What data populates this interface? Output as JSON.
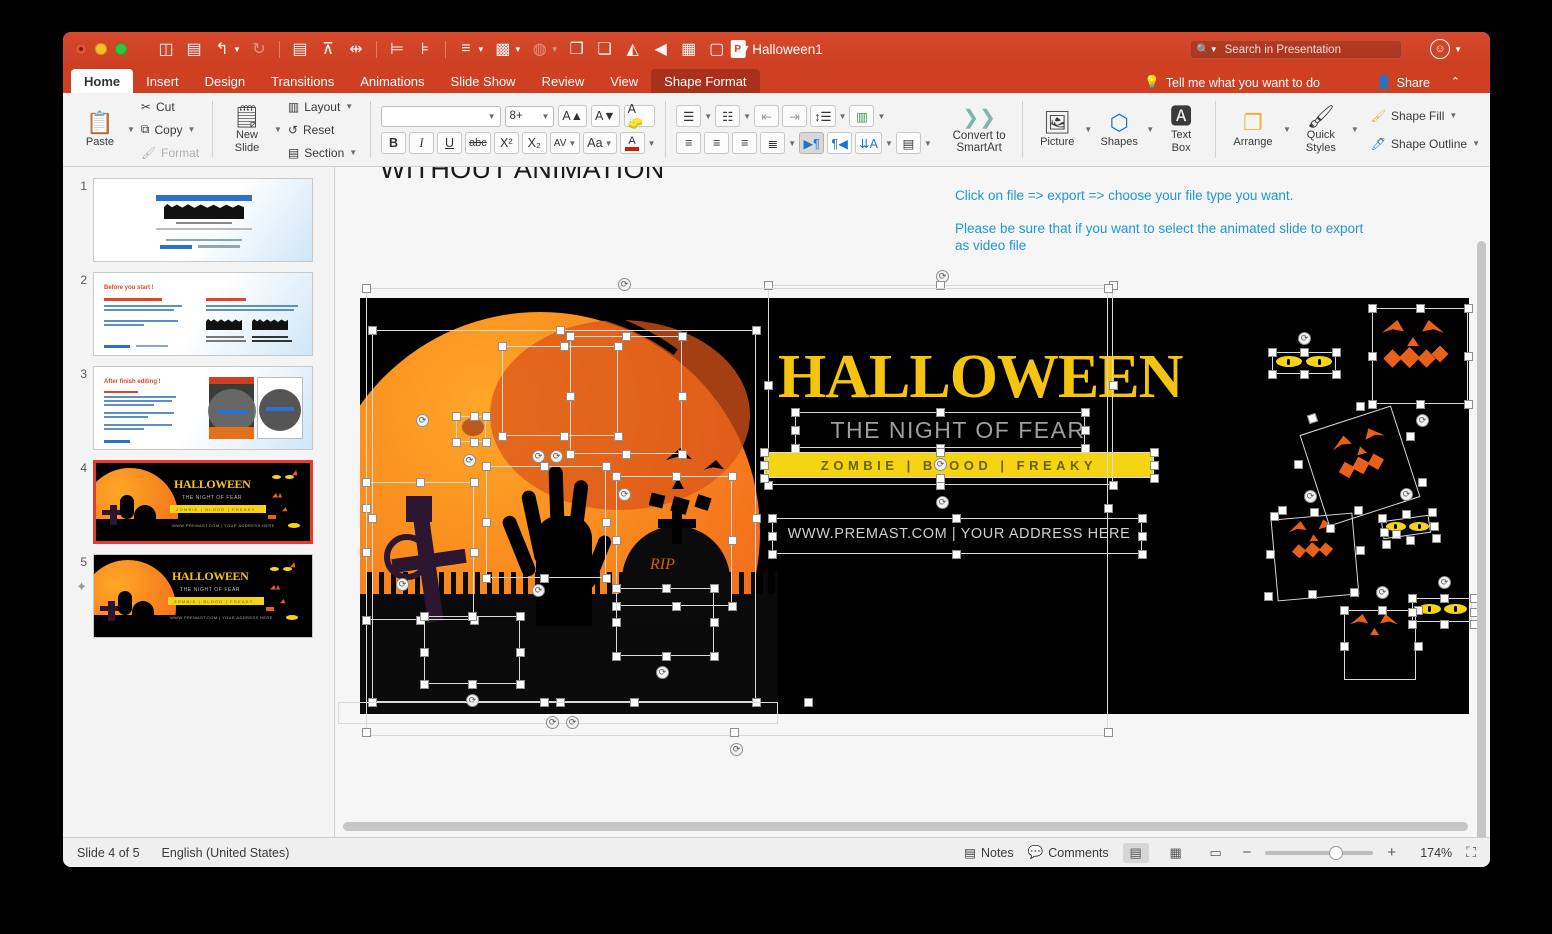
{
  "window": {
    "title": "Halloween1",
    "traffic_lights": [
      "close",
      "minimize",
      "maximize"
    ]
  },
  "quick_access": [
    {
      "name": "sidebar-toggle-icon",
      "glyph": "◫"
    },
    {
      "name": "save-icon",
      "glyph": "▤"
    },
    {
      "name": "undo-icon",
      "glyph": "↰",
      "caret": true
    },
    {
      "name": "redo-icon",
      "glyph": "↻",
      "disabled": true
    },
    {
      "name": "align-grid-icon",
      "glyph": "▤"
    },
    {
      "name": "align-top-icon",
      "glyph": "⊼"
    },
    {
      "name": "align-center-vertical-icon",
      "glyph": "⇹"
    },
    {
      "name": "align-left-icon",
      "glyph": "⊨"
    },
    {
      "name": "align-right-icon",
      "glyph": "⊧"
    },
    {
      "name": "distribute-icon",
      "glyph": "≡",
      "caret": true
    },
    {
      "name": "group-objects-icon",
      "glyph": "▩",
      "caret": true
    },
    {
      "name": "rotate-fill-icon",
      "glyph": "◍",
      "caret": true,
      "disabled": true
    },
    {
      "name": "bring-forward-icon",
      "glyph": "❐"
    },
    {
      "name": "send-backward-icon",
      "glyph": "❑"
    },
    {
      "name": "flip-icon",
      "glyph": "◭"
    },
    {
      "name": "play-icon",
      "glyph": "◀"
    },
    {
      "name": "picture-icon",
      "glyph": "▦"
    },
    {
      "name": "new-slide-icon",
      "glyph": "▢"
    },
    {
      "name": "more-icon",
      "glyph": "▾"
    }
  ],
  "search": {
    "placeholder": "Search in Presentation",
    "icon": "Q"
  },
  "tabs": [
    {
      "label": "Home",
      "state": "active"
    },
    {
      "label": "Insert",
      "state": "normal"
    },
    {
      "label": "Design",
      "state": "normal"
    },
    {
      "label": "Transitions",
      "state": "normal"
    },
    {
      "label": "Animations",
      "state": "normal"
    },
    {
      "label": "Slide Show",
      "state": "normal"
    },
    {
      "label": "Review",
      "state": "normal"
    },
    {
      "label": "View",
      "state": "normal"
    },
    {
      "label": "Shape Format",
      "state": "context"
    }
  ],
  "tell_me": "Tell me what you want to do",
  "share": "Share",
  "ribbon": {
    "clipboard": {
      "paste": "Paste",
      "cut": "Cut",
      "copy": "Copy",
      "format": "Format"
    },
    "slides": {
      "new_slide": "New\nSlide",
      "new_slide_l1": "New",
      "new_slide_l2": "Slide",
      "layout": "Layout",
      "reset": "Reset",
      "section": "Section"
    },
    "font": {
      "font_name": "",
      "font_size": "8+",
      "grow": "A▲",
      "shrink": "A▼",
      "clear_formatting": "A",
      "bold": "B",
      "italic": "I",
      "underline": "U",
      "strikethrough": "abc",
      "superscript": "X²",
      "subscript": "X₂",
      "character_spacing": "AV",
      "change_case": "Aa",
      "font_color": "A"
    },
    "paragraph": {
      "bullets": "▤",
      "numbering": "▤",
      "decrease_indent": "⇤",
      "increase_indent": "⇥",
      "line_spacing": "↕",
      "columns": "▥",
      "align_left": "≡",
      "align_center": "≡",
      "align_right": "≡",
      "justify": "≡",
      "ltr": "¶",
      "rtl": "¶",
      "text_direction": "A",
      "align_text": "▤",
      "convert_to_smartart_l1": "Convert to",
      "convert_to_smartart_l2": "SmartArt"
    },
    "insert": {
      "picture": "Picture",
      "shapes": "Shapes",
      "text_box_l1": "Text",
      "text_box_l2": "Box"
    },
    "format": {
      "arrange": "Arrange",
      "quick_styles_l1": "Quick",
      "quick_styles_l2": "Styles",
      "shape_fill": "Shape Fill",
      "shape_outline": "Shape Outline"
    }
  },
  "slides_panel": [
    {
      "number": "1",
      "selected": false,
      "starred": false
    },
    {
      "number": "2",
      "selected": false,
      "starred": false
    },
    {
      "number": "3",
      "selected": false,
      "starred": false
    },
    {
      "number": "4",
      "selected": true,
      "starred": false
    },
    {
      "number": "5",
      "selected": false,
      "starred": true
    }
  ],
  "slide_thumbs": {
    "s1_title": "HALLOWEEN",
    "s2_heading": "Before you start !",
    "s3_heading": "After finish editing !"
  },
  "canvas": {
    "title_above": "WITHOUT ANIMATION",
    "note_1": "Click on file => export => choose your file type you want.",
    "note_2": "Please be sure that if you want to select the animated slide to export as video file",
    "note_color": "#2196d6"
  },
  "slide_content": {
    "headline": "HALLOWEEN",
    "subtitle": "THE NIGHT OF FEAR",
    "tagline": "ZOMBIE  |  BLOOD  |  FREAKY",
    "address": "WWW.PREMAST.COM | YOUR ADDRESS HERE",
    "rip": "RIP",
    "headline_color": "#f5c40f",
    "tagline_bg": "#f5d414",
    "background": "#000000",
    "moon_color": "#f9861f"
  },
  "status": {
    "slide_of": "Slide 4 of 5",
    "language": "English (United States)",
    "notes": "Notes",
    "comments": "Comments",
    "zoom": "174%",
    "zoom_out": "−",
    "zoom_in": "+",
    "view_normal": "▤",
    "view_sorter": "▦",
    "view_reading": "▭",
    "fit_slide": "⛶"
  }
}
